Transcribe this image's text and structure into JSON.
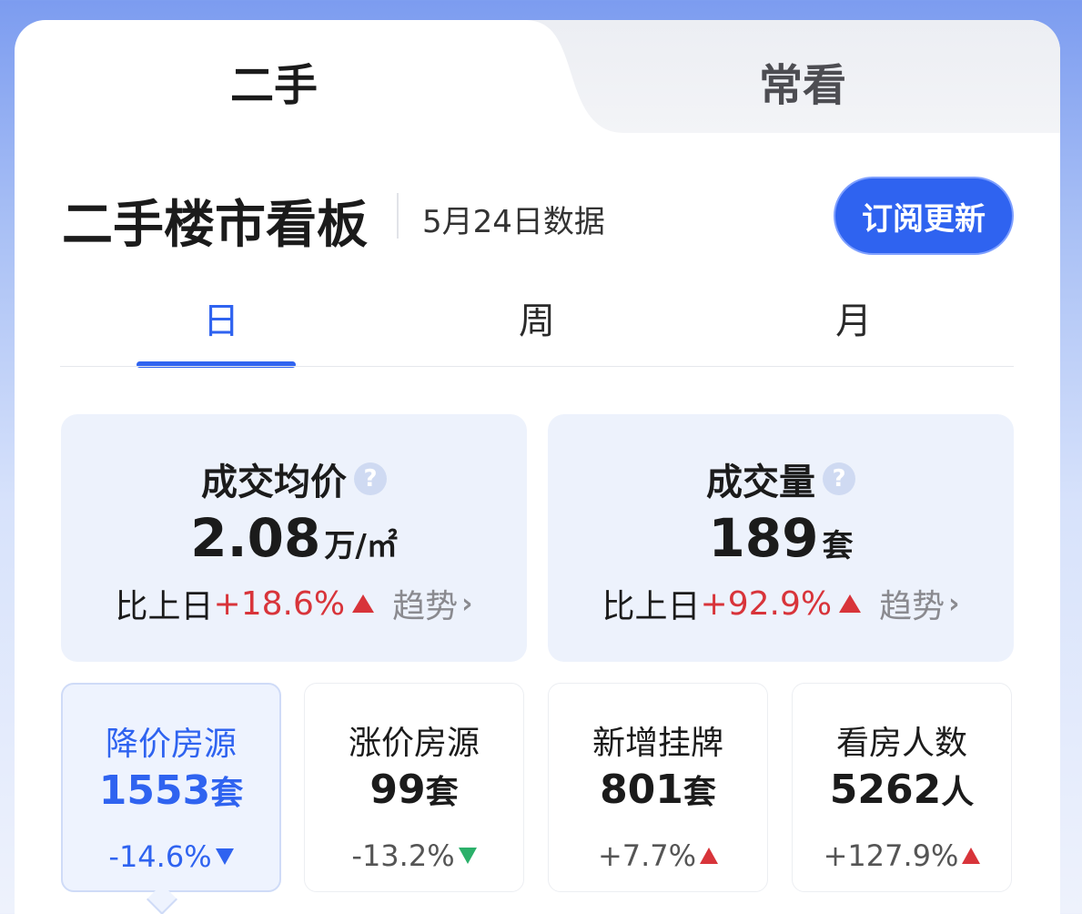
{
  "top_tabs": [
    {
      "label": "二手",
      "active": true
    },
    {
      "label": "常看",
      "active": false
    }
  ],
  "header": {
    "title": "二手楼市看板",
    "date": "5月24日数据",
    "subscribe_label": "订阅更新"
  },
  "period_tabs": [
    {
      "label": "日",
      "active": true
    },
    {
      "label": "周",
      "active": false
    },
    {
      "label": "月",
      "active": false
    }
  ],
  "stats": [
    {
      "label": "成交均价",
      "help": "?",
      "value": "2.08",
      "unit": "万/㎡",
      "compare_label": "比上日",
      "compare_value": "+18.6%",
      "direction": "up",
      "trend_label": "趋势",
      "chevron": "›"
    },
    {
      "label": "成交量",
      "help": "?",
      "value": "189",
      "unit": "套",
      "compare_label": "比上日",
      "compare_value": "+92.9%",
      "direction": "up",
      "trend_label": "趋势",
      "chevron": "›"
    }
  ],
  "mini_stats": [
    {
      "label": "降价房源",
      "value": "1553",
      "unit": "套",
      "change": "-14.6%",
      "direction": "down",
      "active": true
    },
    {
      "label": "涨价房源",
      "value": "99",
      "unit": "套",
      "change": "-13.2%",
      "direction": "down",
      "active": false
    },
    {
      "label": "新增挂牌",
      "value": "801",
      "unit": "套",
      "change": "+7.7%",
      "direction": "up",
      "active": false
    },
    {
      "label": "看房人数",
      "value": "5262",
      "unit": "人",
      "change": "+127.9%",
      "direction": "up",
      "active": false
    }
  ],
  "colors": {
    "accent": "#2f63f0",
    "up": "#d8343a",
    "down_green": "#2bb06a",
    "card_bg": "#edf2fc"
  },
  "icons": {
    "help": "help-circle-icon",
    "chevron": "chevron-right-icon",
    "triangle_up": "triangle-up-icon",
    "triangle_down": "triangle-down-icon"
  }
}
